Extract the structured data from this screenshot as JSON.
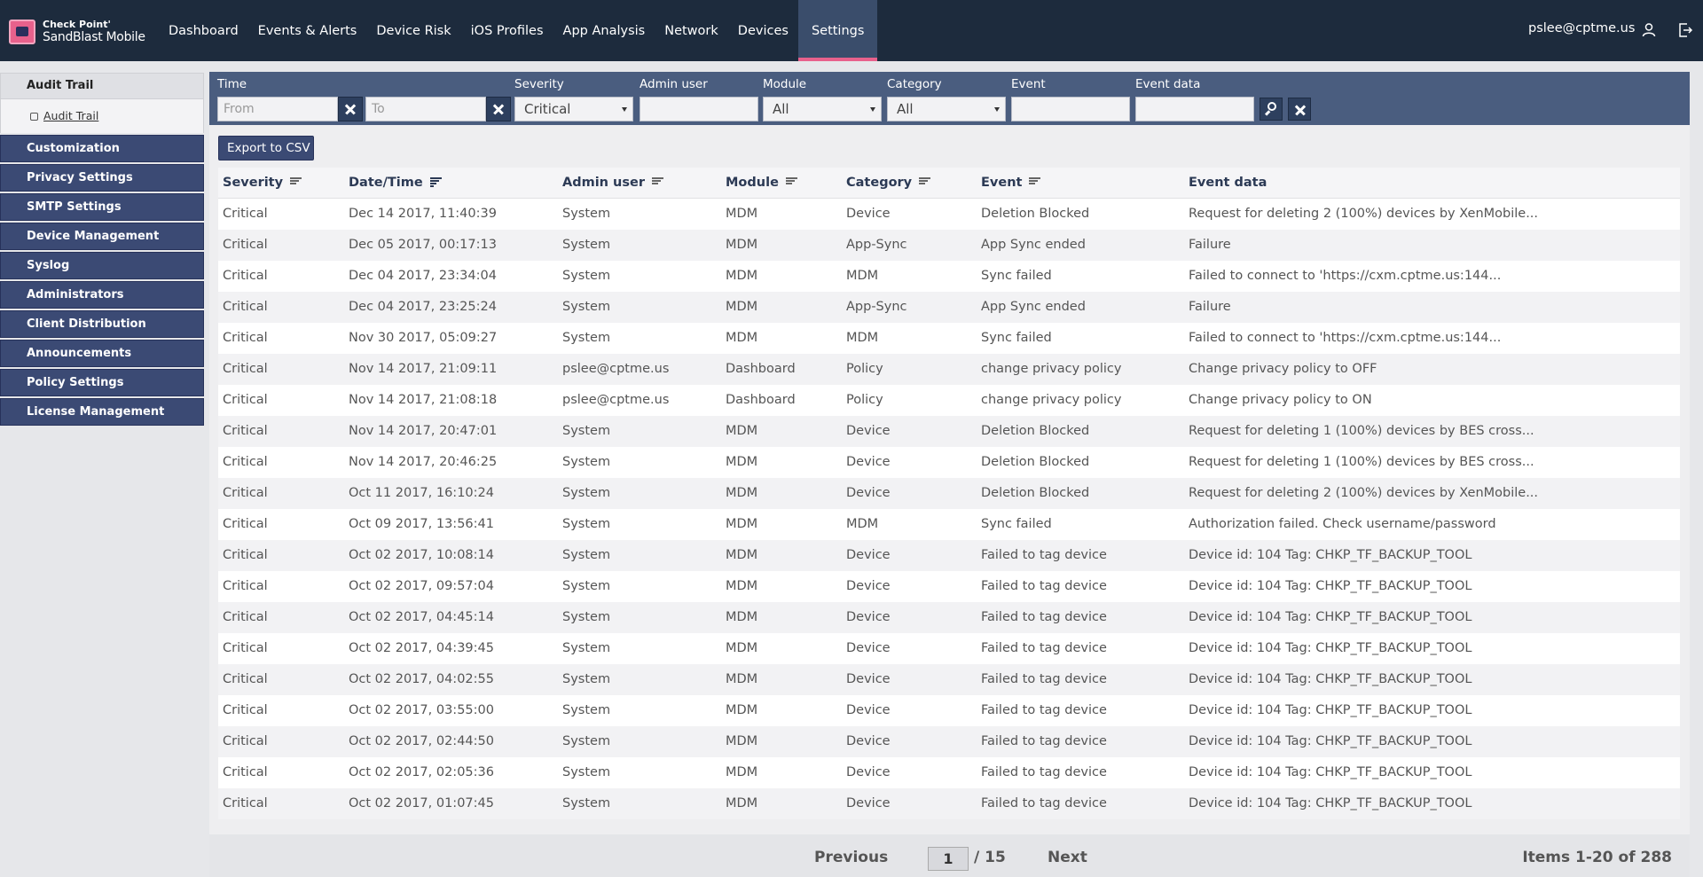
{
  "brand": {
    "line1": "Check Point'",
    "line2": "SandBlast Mobile"
  },
  "nav": [
    {
      "label": "Dashboard"
    },
    {
      "label": "Events & Alerts"
    },
    {
      "label": "Device Risk"
    },
    {
      "label": "iOS Profiles"
    },
    {
      "label": "App Analysis"
    },
    {
      "label": "Network"
    },
    {
      "label": "Devices"
    },
    {
      "label": "Settings",
      "active": true
    }
  ],
  "user": {
    "email": "pslee@cptme.us"
  },
  "sidebar": {
    "section": "Audit Trail",
    "sub_item": "Audit Trail",
    "items": [
      {
        "label": "Customization"
      },
      {
        "label": "Privacy Settings"
      },
      {
        "label": "SMTP Settings"
      },
      {
        "label": "Device Management"
      },
      {
        "label": "Syslog"
      },
      {
        "label": "Administrators"
      },
      {
        "label": "Client Distribution"
      },
      {
        "label": "Announcements"
      },
      {
        "label": "Policy Settings"
      },
      {
        "label": "License Management"
      }
    ]
  },
  "filters": {
    "time_label": "Time",
    "from_placeholder": "From",
    "to_placeholder": "To",
    "severity_label": "Severity",
    "severity_value": "Critical",
    "admin_label": "Admin user",
    "module_label": "Module",
    "module_value": "All",
    "category_label": "Category",
    "category_value": "All",
    "event_label": "Event",
    "event_data_label": "Event data"
  },
  "export_label": "Export to CSV",
  "table": {
    "columns": [
      "Severity",
      "Date/Time",
      "Admin user",
      "Module",
      "Category",
      "Event",
      "Event data"
    ],
    "rows": [
      [
        "Critical",
        "Dec 14 2017, 11:40:39",
        "System",
        "MDM",
        "Device",
        "Deletion Blocked",
        "Request for deleting 2 (100%) devices by XenMobile..."
      ],
      [
        "Critical",
        "Dec 05 2017, 00:17:13",
        "System",
        "MDM",
        "App-Sync",
        "App Sync ended",
        "Failure"
      ],
      [
        "Critical",
        "Dec 04 2017, 23:34:04",
        "System",
        "MDM",
        "MDM",
        "Sync failed",
        "Failed to connect to 'https://cxm.cptme.us:144..."
      ],
      [
        "Critical",
        "Dec 04 2017, 23:25:24",
        "System",
        "MDM",
        "App-Sync",
        "App Sync ended",
        "Failure"
      ],
      [
        "Critical",
        "Nov 30 2017, 05:09:27",
        "System",
        "MDM",
        "MDM",
        "Sync failed",
        "Failed to connect to 'https://cxm.cptme.us:144..."
      ],
      [
        "Critical",
        "Nov 14 2017, 21:09:11",
        "pslee@cptme.us",
        "Dashboard",
        "Policy",
        "change privacy policy",
        "Change privacy policy to OFF"
      ],
      [
        "Critical",
        "Nov 14 2017, 21:08:18",
        "pslee@cptme.us",
        "Dashboard",
        "Policy",
        "change privacy policy",
        "Change privacy policy to ON"
      ],
      [
        "Critical",
        "Nov 14 2017, 20:47:01",
        "System",
        "MDM",
        "Device",
        "Deletion Blocked",
        "Request for deleting 1 (100%) devices by BES cross..."
      ],
      [
        "Critical",
        "Nov 14 2017, 20:46:25",
        "System",
        "MDM",
        "Device",
        "Deletion Blocked",
        "Request for deleting 1 (100%) devices by BES cross..."
      ],
      [
        "Critical",
        "Oct 11 2017, 16:10:24",
        "System",
        "MDM",
        "Device",
        "Deletion Blocked",
        "Request for deleting 2 (100%) devices by XenMobile..."
      ],
      [
        "Critical",
        "Oct 09 2017, 13:56:41",
        "System",
        "MDM",
        "MDM",
        "Sync failed",
        "Authorization failed. Check username/password"
      ],
      [
        "Critical",
        "Oct 02 2017, 10:08:14",
        "System",
        "MDM",
        "Device",
        "Failed to tag device",
        "Device id: 104 Tag: CHKP_TF_BACKUP_TOOL"
      ],
      [
        "Critical",
        "Oct 02 2017, 09:57:04",
        "System",
        "MDM",
        "Device",
        "Failed to tag device",
        "Device id: 104 Tag: CHKP_TF_BACKUP_TOOL"
      ],
      [
        "Critical",
        "Oct 02 2017, 04:45:14",
        "System",
        "MDM",
        "Device",
        "Failed to tag device",
        "Device id: 104 Tag: CHKP_TF_BACKUP_TOOL"
      ],
      [
        "Critical",
        "Oct 02 2017, 04:39:45",
        "System",
        "MDM",
        "Device",
        "Failed to tag device",
        "Device id: 104 Tag: CHKP_TF_BACKUP_TOOL"
      ],
      [
        "Critical",
        "Oct 02 2017, 04:02:55",
        "System",
        "MDM",
        "Device",
        "Failed to tag device",
        "Device id: 104 Tag: CHKP_TF_BACKUP_TOOL"
      ],
      [
        "Critical",
        "Oct 02 2017, 03:55:00",
        "System",
        "MDM",
        "Device",
        "Failed to tag device",
        "Device id: 104 Tag: CHKP_TF_BACKUP_TOOL"
      ],
      [
        "Critical",
        "Oct 02 2017, 02:44:50",
        "System",
        "MDM",
        "Device",
        "Failed to tag device",
        "Device id: 104 Tag: CHKP_TF_BACKUP_TOOL"
      ],
      [
        "Critical",
        "Oct 02 2017, 02:05:36",
        "System",
        "MDM",
        "Device",
        "Failed to tag device",
        "Device id: 104 Tag: CHKP_TF_BACKUP_TOOL"
      ],
      [
        "Critical",
        "Oct 02 2017, 01:07:45",
        "System",
        "MDM",
        "Device",
        "Failed to tag device",
        "Device id: 104 Tag: CHKP_TF_BACKUP_TOOL"
      ]
    ]
  },
  "pagination": {
    "previous": "Previous",
    "current": "1",
    "total": "/ 15",
    "next": "Next",
    "items": "Items 1-20 of 288"
  }
}
